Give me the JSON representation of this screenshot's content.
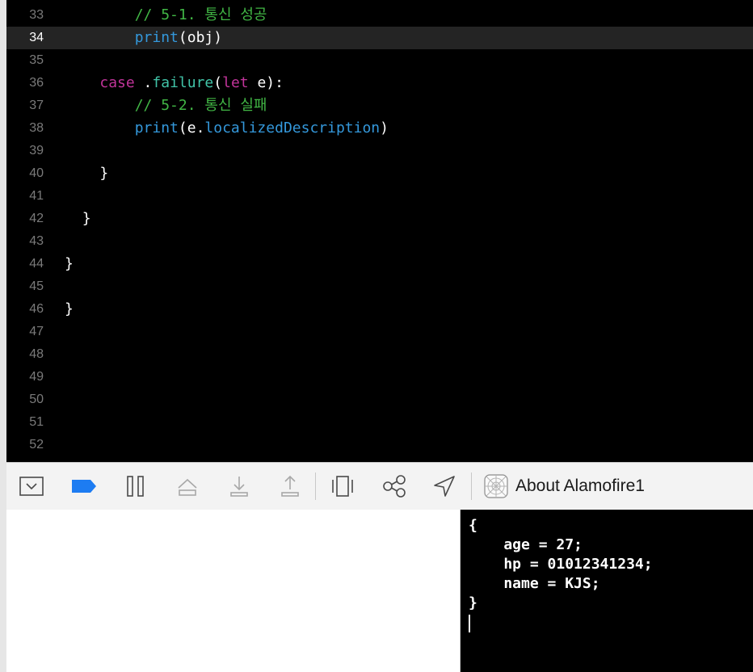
{
  "editor": {
    "current_line": "34",
    "lines": [
      {
        "num": "33",
        "indent": "        ",
        "parts": [
          {
            "t": "// 5-1. 통신 성공",
            "c": "comment"
          }
        ]
      },
      {
        "num": "34",
        "indent": "        ",
        "parts": [
          {
            "t": "print",
            "c": "func"
          },
          {
            "t": "(obj)",
            "c": "ident"
          }
        ]
      },
      {
        "num": "35",
        "indent": "",
        "parts": []
      },
      {
        "num": "36",
        "indent": "    ",
        "parts": [
          {
            "t": "case",
            "c": "keyword"
          },
          {
            "t": " .",
            "c": "ident"
          },
          {
            "t": "failure",
            "c": "member"
          },
          {
            "t": "(",
            "c": "ident"
          },
          {
            "t": "let",
            "c": "keyword"
          },
          {
            "t": " e):",
            "c": "ident"
          }
        ]
      },
      {
        "num": "37",
        "indent": "        ",
        "parts": [
          {
            "t": "// 5-2. 통신 실패",
            "c": "comment"
          }
        ]
      },
      {
        "num": "38",
        "indent": "        ",
        "parts": [
          {
            "t": "print",
            "c": "func"
          },
          {
            "t": "(e.",
            "c": "ident"
          },
          {
            "t": "localizedDescription",
            "c": "func"
          },
          {
            "t": ")",
            "c": "ident"
          }
        ]
      },
      {
        "num": "39",
        "indent": "",
        "parts": []
      },
      {
        "num": "40",
        "indent": "    ",
        "parts": [
          {
            "t": "}",
            "c": "ident"
          }
        ]
      },
      {
        "num": "41",
        "indent": "",
        "parts": []
      },
      {
        "num": "42",
        "indent": "  ",
        "parts": [
          {
            "t": "}",
            "c": "ident"
          }
        ]
      },
      {
        "num": "43",
        "indent": "",
        "parts": []
      },
      {
        "num": "44",
        "indent": "",
        "parts": [
          {
            "t": "}",
            "c": "ident"
          }
        ]
      },
      {
        "num": "45",
        "indent": "",
        "parts": []
      },
      {
        "num": "46",
        "indent": "",
        "parts": [
          {
            "t": "}",
            "c": "ident"
          }
        ]
      },
      {
        "num": "47",
        "indent": "",
        "parts": []
      },
      {
        "num": "48",
        "indent": "",
        "parts": []
      },
      {
        "num": "49",
        "indent": "",
        "parts": []
      },
      {
        "num": "50",
        "indent": "",
        "parts": []
      },
      {
        "num": "51",
        "indent": "",
        "parts": []
      },
      {
        "num": "52",
        "indent": "",
        "parts": []
      }
    ]
  },
  "debug_bar": {
    "process_label": "About Alamofire1",
    "icons": [
      "hide-debug-area-icon",
      "breakpoints-toggle-icon",
      "pause-icon",
      "step-over-icon",
      "step-into-icon",
      "step-out-icon",
      "view-hierarchy-icon",
      "memory-graph-icon",
      "simulate-location-icon",
      "app-icon"
    ]
  },
  "console": {
    "lines": [
      "{",
      "    age = 27;",
      "    hp = 01012341234;",
      "    name = KJS;",
      "}"
    ]
  },
  "colors": {
    "comment": "#41b645",
    "keyword": "#c2349b",
    "member": "#41c4a8",
    "func": "#3498db",
    "accent": "#1d7cf2"
  }
}
